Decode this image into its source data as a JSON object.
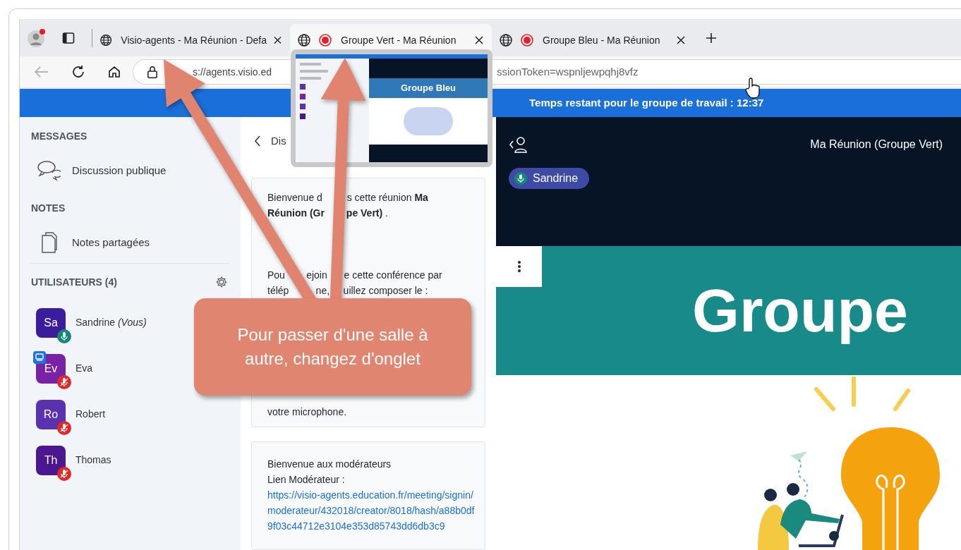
{
  "browser": {
    "tabs": [
      {
        "title": "Visio-agents - Ma Réunion - Defa",
        "recording": false,
        "selected": false
      },
      {
        "title": "Groupe Vert - Ma Réunion",
        "recording": true,
        "selected": true
      },
      {
        "title": "Groupe Bleu - Ma Réunion",
        "recording": true,
        "selected": false
      }
    ],
    "address": {
      "visible_start": "s://agents.visio.ed",
      "visible_end": "ssionToken=wspnljewpqhj8vfz"
    },
    "tab_preview": {
      "banner_title": "Groupe Bleu"
    }
  },
  "timer_bar": {
    "text": "Temps restant pour le groupe de travail : 12:37"
  },
  "sidebar": {
    "sections": [
      {
        "title": "MESSAGES",
        "items": [
          {
            "label": "Discussion publique",
            "kind": "chat"
          }
        ]
      },
      {
        "title": "NOTES",
        "items": [
          {
            "label": "Notes partagées",
            "kind": "notes"
          }
        ]
      }
    ],
    "users_title": "UTILISATEURS (4)",
    "users": [
      {
        "initials": "Sa",
        "name": "Sandrine *(Vous)*",
        "color": "#3b1c9c",
        "muted": false,
        "presenter": false
      },
      {
        "initials": "Ev",
        "name": "Eva",
        "color": "#7a22a6",
        "muted": true,
        "presenter": true
      },
      {
        "initials": "Ro",
        "name": "Robert",
        "color": "#5a32b0",
        "muted": true,
        "presenter": false
      },
      {
        "initials": "Th",
        "name": "Thomas",
        "color": "#4b168f",
        "muted": true,
        "presenter": false
      }
    ]
  },
  "chat": {
    "header": "Dis",
    "messages": [
      {
        "paragraphs": [
          {
            "lines": [
              [
                "Bienvenue d",
                "s cette réunion **Ma**"
              ],
              [
                "**Réunion (Gr**",
                "**pe Vert)** ."
              ]
            ]
          },
          {
            "lines": [
              [
                "Pou",
                "ejoin",
                "e cette conférence par"
              ],
              [
                "télép",
                "ne,",
                "uillez composer le :"
              ]
            ]
          },
          {
            "lines": [
              [
                "votre microphone."
              ]
            ]
          }
        ]
      },
      {
        "paragraphs": [
          {
            "lines": [
              [
                "Bienvenue aux modérateurs"
              ],
              [
                "Lien Modérateur :"
              ]
            ]
          }
        ],
        "link": "https://visio-agents.education.fr/meeting/signin/moderateur/432018/creator/8018/hash/a88b0df9f03c44712e3104e353d85743dd6db3c9"
      }
    ]
  },
  "presentation": {
    "meeting_title": "Ma Réunion (Groupe Vert)",
    "speaker": "Sandrine",
    "slide_title": "Groupe"
  },
  "annotation": {
    "text": "Pour passer d'une salle à autre, changez d'onglet"
  }
}
